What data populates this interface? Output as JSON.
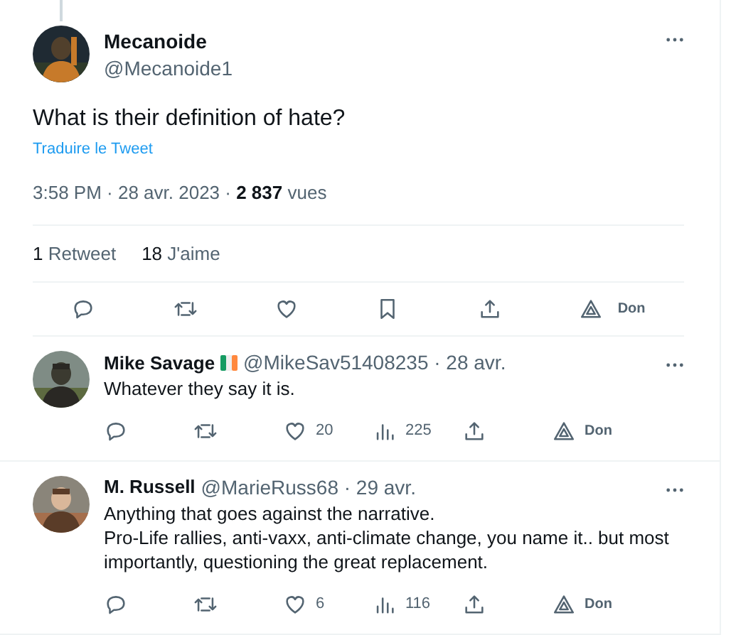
{
  "main_tweet": {
    "name": "Mecanoide",
    "handle": "@Mecanoide1",
    "text": "What is their definition of hate?",
    "translate": "Traduire le Tweet",
    "meta": "3:58 PM · 28 avr. 2023 · ",
    "views": "2 837",
    "views_label": "vues",
    "stats": [
      {
        "count": "1",
        "label": "Retweet"
      },
      {
        "count": "18",
        "label": "J'aime"
      }
    ],
    "actions": [
      {
        "kind": "reply"
      },
      {
        "kind": "retweet"
      },
      {
        "kind": "like"
      },
      {
        "kind": "bookmark"
      },
      {
        "kind": "share"
      },
      {
        "kind": "donate",
        "label": "Don"
      }
    ]
  },
  "replies": [
    {
      "name": "Mike Savage",
      "flag": true,
      "handle": "@MikeSav51408235",
      "date": "· 28 avr.",
      "text": "Whatever they say it is.",
      "actions": [
        {
          "kind": "reply"
        },
        {
          "kind": "retweet"
        },
        {
          "kind": "like",
          "count": "20"
        },
        {
          "kind": "views",
          "count": "225"
        },
        {
          "kind": "share"
        },
        {
          "kind": "donate",
          "label": "Don"
        }
      ]
    },
    {
      "name": "M. Russell",
      "flag": false,
      "handle": "@MarieRuss68",
      "date": "· 29 avr.",
      "text": "Anything that goes against the narrative.\nPro-Life rallies, anti-vaxx, anti-climate change, you name it.. but most importantly, questioning the great replacement.",
      "actions": [
        {
          "kind": "reply"
        },
        {
          "kind": "retweet"
        },
        {
          "kind": "like",
          "count": "6"
        },
        {
          "kind": "views",
          "count": "116"
        },
        {
          "kind": "share"
        },
        {
          "kind": "donate",
          "label": "Don"
        }
      ]
    }
  ]
}
